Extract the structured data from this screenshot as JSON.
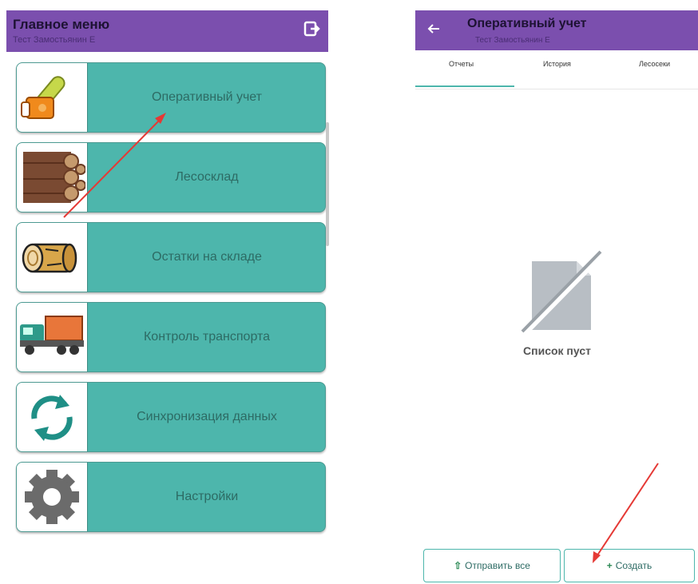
{
  "left": {
    "title": "Главное меню",
    "subtitle": "Тест Замостьянин Е",
    "menu": [
      {
        "label": "Оперативный учет",
        "icon": "chainsaw-icon"
      },
      {
        "label": "Лесосклад",
        "icon": "log-stack-icon"
      },
      {
        "label": "Остатки на складе",
        "icon": "log-icon"
      },
      {
        "label": "Контроль транспорта",
        "icon": "timber-truck-icon"
      },
      {
        "label": "Синхронизация данных",
        "icon": "sync-icon"
      },
      {
        "label": "Настройки",
        "icon": "gear-icon"
      }
    ]
  },
  "right": {
    "title": "Оперативный учет",
    "subtitle": "Тест Замостьянин Е",
    "tabs": [
      "Отчеты",
      "История",
      "Лесосеки"
    ],
    "empty_text": "Список пуст",
    "send_all_label": "Отправить все",
    "create_label": "Создать"
  },
  "colors": {
    "appbar": "#7b4fae",
    "menu_button": "#4db6ac",
    "annotation_arrow": "#e53935"
  }
}
